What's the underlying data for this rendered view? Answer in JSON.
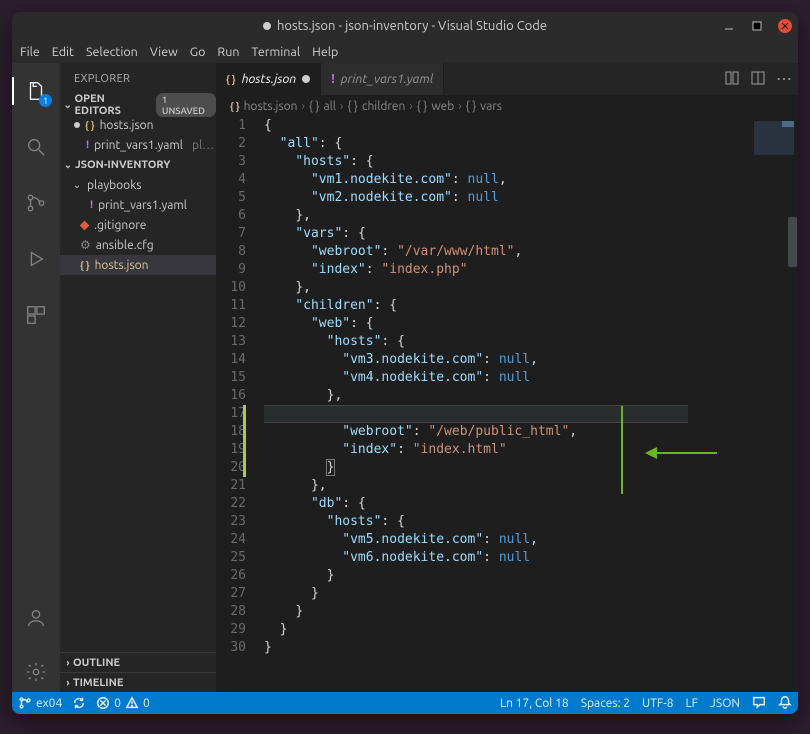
{
  "titlebar": {
    "title": "hosts.json - json-inventory - Visual Studio Code"
  },
  "menu": [
    "File",
    "Edit",
    "Selection",
    "View",
    "Go",
    "Run",
    "Terminal",
    "Help"
  ],
  "activitybar": {
    "explorer_badge": "1"
  },
  "sidebar": {
    "title": "EXPLORER",
    "open_editors_label": "OPEN EDITORS",
    "open_editors_badge": "1 UNSAVED",
    "open_editor_1": "hosts.json",
    "open_editor_2": "print_vars1.yaml",
    "open_editor_2_dim": "pl…",
    "workspace_label": "JSON-INVENTORY",
    "folder_playbooks": "playbooks",
    "file_print_vars": "print_vars1.yaml",
    "file_gitignore": ".gitignore",
    "file_ansiblecfg": "ansible.cfg",
    "file_hosts": "hosts.json",
    "outline_label": "OUTLINE",
    "timeline_label": "TIMELINE"
  },
  "tabs": {
    "tab1": "hosts.json",
    "tab2": "print_vars1.yaml"
  },
  "breadcrumbs": {
    "b1": "hosts.json",
    "b2": "all",
    "b3": "children",
    "b4": "web",
    "b5": "vars"
  },
  "code": {
    "lines": 30,
    "key_all": "\"all\"",
    "key_hosts": "\"hosts\"",
    "key_vars": "\"vars\"",
    "key_webroot": "\"webroot\"",
    "key_index": "\"index\"",
    "key_children": "\"children\"",
    "key_web": "\"web\"",
    "key_db": "\"db\"",
    "key_vm1": "\"vm1.nodekite.com\"",
    "key_vm2": "\"vm2.nodekite.com\"",
    "key_vm3": "\"vm3.nodekite.com\"",
    "key_vm4": "\"vm4.nodekite.com\"",
    "key_vm5": "\"vm5.nodekite.com\"",
    "key_vm6": "\"vm6.nodekite.com\"",
    "val_varwww": "\"/var/www/html\"",
    "val_indexphp": "\"index.php\"",
    "val_webpublic": "\"/web/public_html\"",
    "val_indexhtml": "\"index.html\"",
    "null": "null"
  },
  "statusbar": {
    "branch": "ex04",
    "problems": "0",
    "warnings": "0",
    "position": "Ln 17, Col 18",
    "spaces": "Spaces: 2",
    "encoding": "UTF-8",
    "eol": "LF",
    "language": "JSON"
  }
}
